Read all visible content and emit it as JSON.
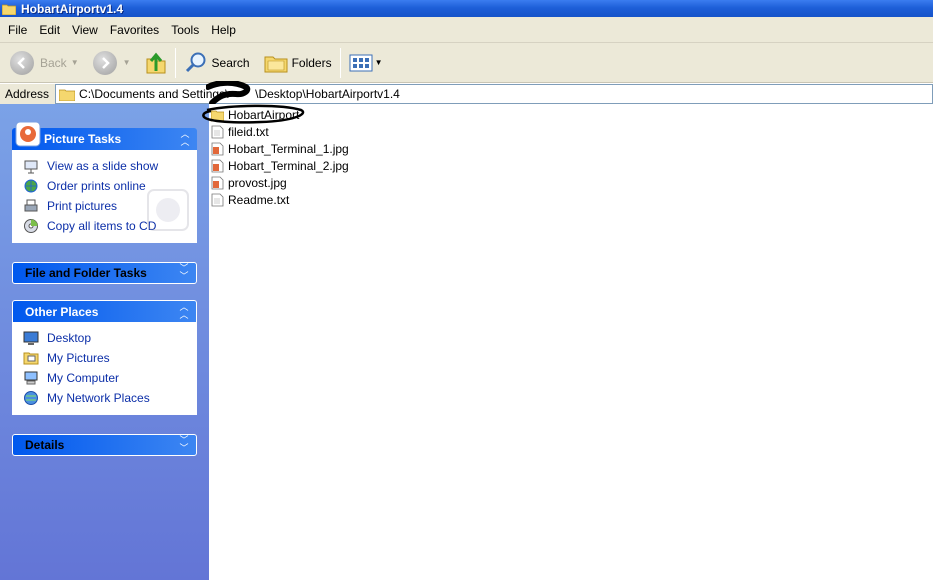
{
  "window": {
    "title": "HobartAirportv1.4"
  },
  "menu": [
    {
      "label": "File"
    },
    {
      "label": "Edit"
    },
    {
      "label": "View"
    },
    {
      "label": "Favorites"
    },
    {
      "label": "Tools"
    },
    {
      "label": "Help"
    }
  ],
  "toolbar": {
    "back_label": "Back",
    "search_label": "Search",
    "folders_label": "Folders"
  },
  "address": {
    "label": "Address",
    "path": "C:\\Documents and Settings\\        \\Desktop\\HobartAirportv1.4"
  },
  "panes": {
    "picture_tasks": {
      "title": "Picture Tasks",
      "items": [
        {
          "label": "View as a slide show",
          "icon": "slideshow-icon"
        },
        {
          "label": "Order prints online",
          "icon": "globe-icon"
        },
        {
          "label": "Print pictures",
          "icon": "printer-icon"
        },
        {
          "label": "Copy all items to CD",
          "icon": "cd-icon"
        }
      ]
    },
    "file_folder_tasks": {
      "title": "File and Folder Tasks"
    },
    "other_places": {
      "title": "Other Places",
      "items": [
        {
          "label": "Desktop",
          "icon": "desktop-icon"
        },
        {
          "label": "My Pictures",
          "icon": "pictures-folder-icon"
        },
        {
          "label": "My Computer",
          "icon": "computer-icon"
        },
        {
          "label": "My Network Places",
          "icon": "network-icon"
        }
      ]
    },
    "details": {
      "title": "Details"
    }
  },
  "files": [
    {
      "name": "HobartAirport",
      "type": "folder"
    },
    {
      "name": "fileid.txt",
      "type": "text"
    },
    {
      "name": "Hobart_Terminal_1.jpg",
      "type": "image"
    },
    {
      "name": "Hobart_Terminal_2.jpg",
      "type": "image"
    },
    {
      "name": "provost.jpg",
      "type": "image"
    },
    {
      "name": "Readme.txt",
      "type": "text"
    }
  ],
  "colors": {
    "title_bar": "#1e5fd8",
    "chrome": "#ece9d8",
    "task_link": "#0c2fa8",
    "pane_bg": "#7ba2e7"
  }
}
